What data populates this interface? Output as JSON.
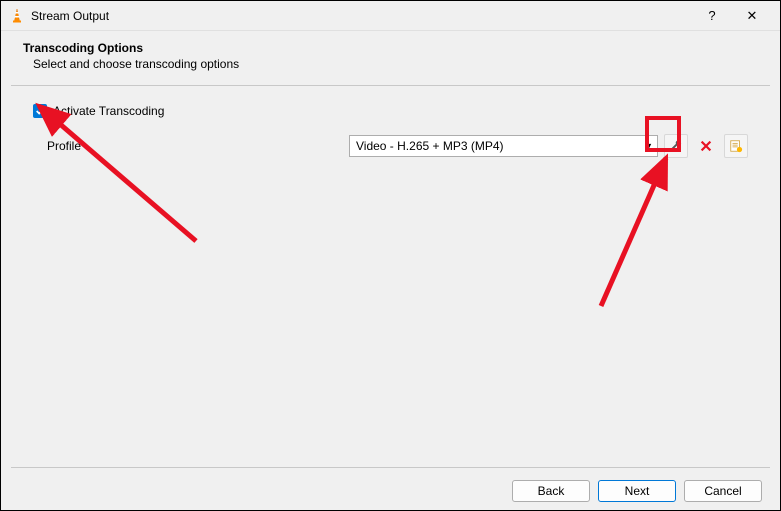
{
  "titlebar": {
    "title": "Stream Output",
    "help": "?",
    "close": "✕"
  },
  "header": {
    "title": "Transcoding Options",
    "subtitle": "Select and choose transcoding options"
  },
  "transcoding": {
    "checkbox_label": "Activate Transcoding",
    "checked": true,
    "profile_label": "Profile",
    "profile_value": "Video - H.265 + MP3 (MP4)"
  },
  "footer": {
    "back": "Back",
    "next": "Next",
    "cancel": "Cancel"
  }
}
